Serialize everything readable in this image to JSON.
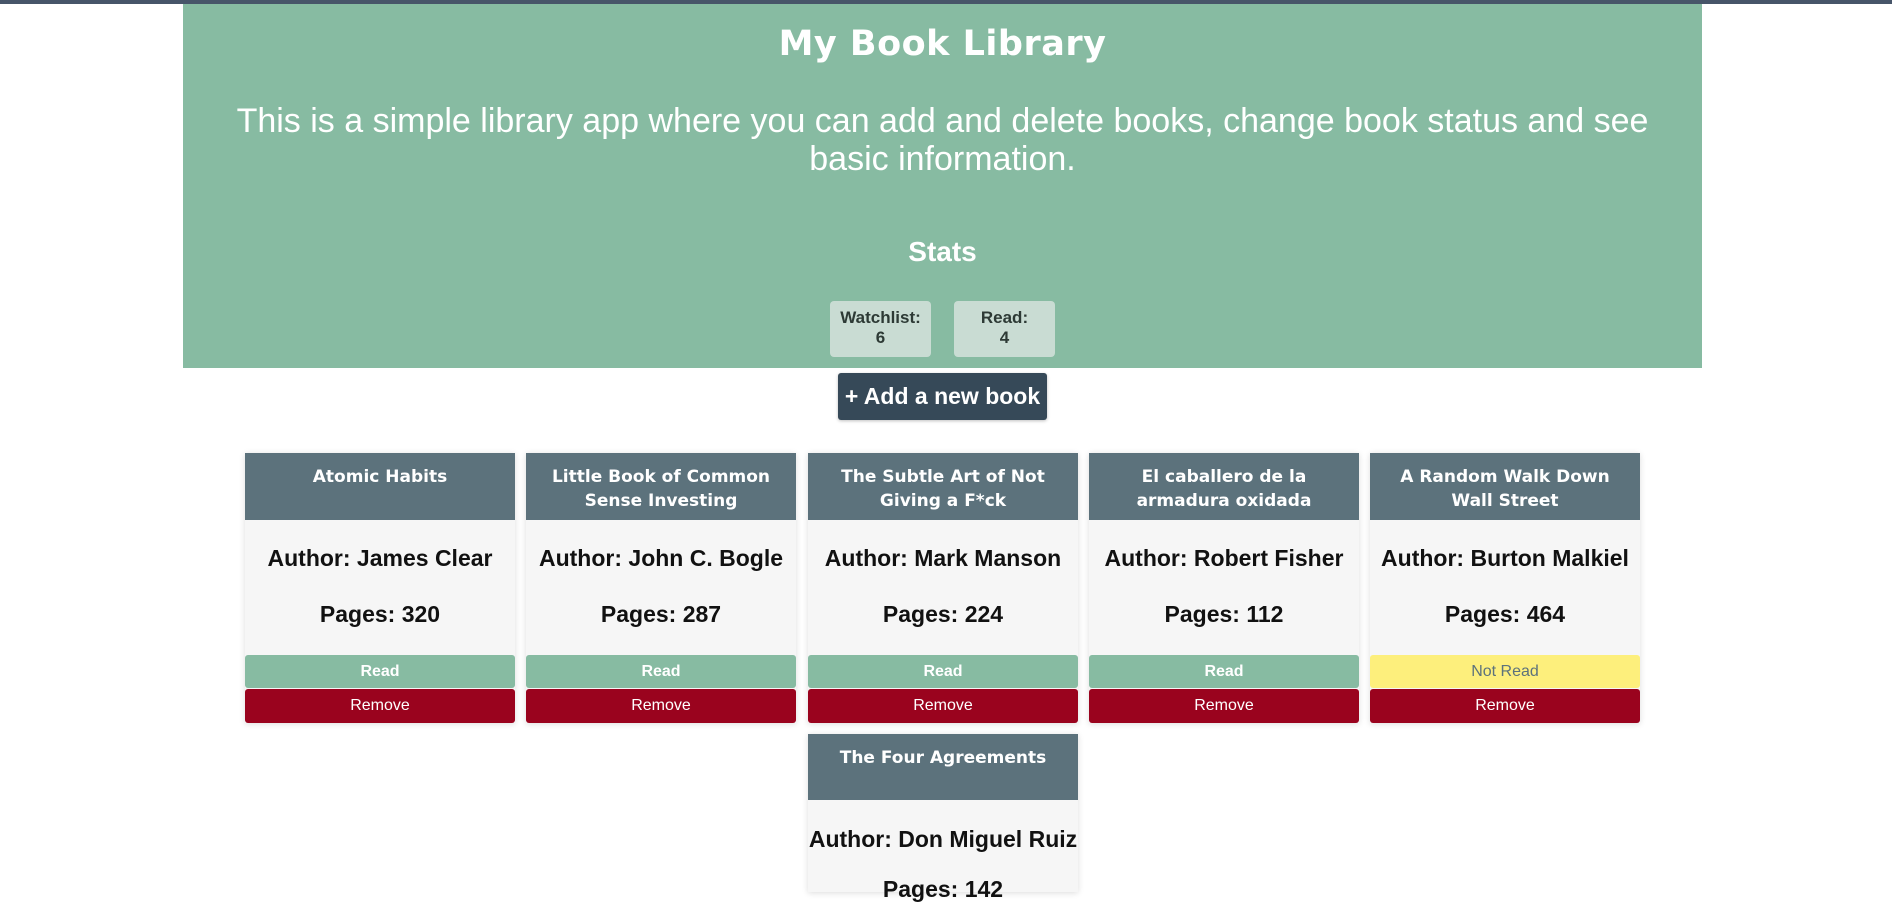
{
  "header": {
    "title": "My Book Library",
    "description": "This is a simple library app where you can add and delete books, change book status and see basic information."
  },
  "stats": {
    "title": "Stats",
    "watchlist_label": "Watchlist:",
    "watchlist_value": "6",
    "read_label": "Read:",
    "read_value": "4"
  },
  "add_button": {
    "label": "+ Add a new book"
  },
  "colors": {
    "hero": "#87bba2",
    "card_header": "#5c727c",
    "add_button": "#364958",
    "read_status": "#87bba2",
    "not_read_status": "#fdef7c",
    "remove": "#9a031e"
  },
  "books": [
    {
      "title": "Atomic Habits",
      "author": "Author: James Clear",
      "pages": "Pages: 320",
      "status": "Read",
      "remove": "Remove"
    },
    {
      "title": "Little Book of Common Sense Investing",
      "author": "Author: John C. Bogle",
      "pages": "Pages: 287",
      "status": "Read",
      "remove": "Remove"
    },
    {
      "title": "The Subtle Art of Not Giving a F*ck",
      "author": "Author: Mark Manson",
      "pages": "Pages: 224",
      "status": "Read",
      "remove": "Remove"
    },
    {
      "title": "El caballero de la armadura oxidada",
      "author": "Author: Robert Fisher",
      "pages": "Pages: 112",
      "status": "Read",
      "remove": "Remove"
    },
    {
      "title": "A Random Walk Down Wall Street",
      "author": "Author: Burton Malkiel",
      "pages": "Pages: 464",
      "status": "Not Read",
      "remove": "Remove"
    },
    {
      "title": "The Four Agreements",
      "author": "Author: Don Miguel Ruiz",
      "pages": "Pages: 142",
      "status": "",
      "remove": ""
    }
  ]
}
